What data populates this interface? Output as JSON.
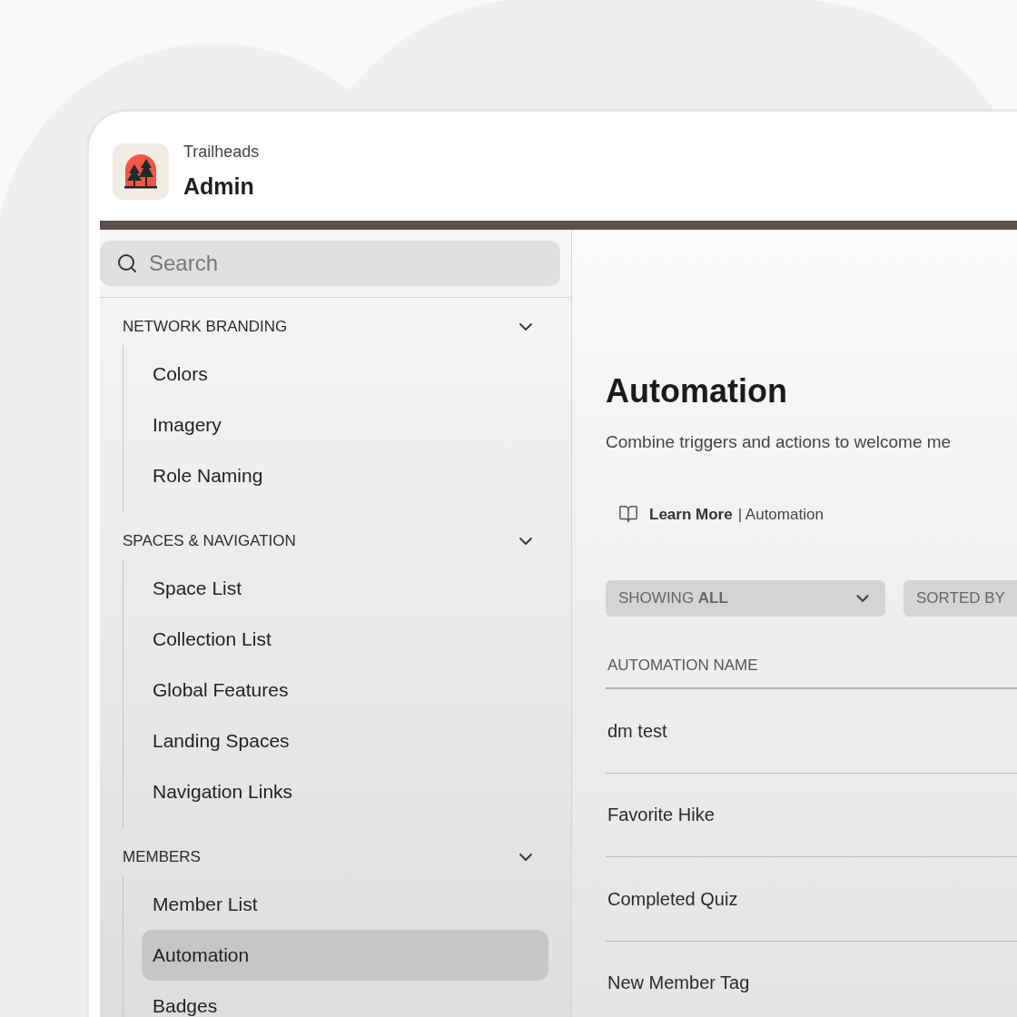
{
  "app": {
    "name": "Trailheads",
    "title": "Admin"
  },
  "sidebar": {
    "search": {
      "placeholder": "Search"
    },
    "sections": [
      {
        "title": "NETWORK BRANDING",
        "expanded": true,
        "items": [
          {
            "label": "Colors",
            "selected": false
          },
          {
            "label": "Imagery",
            "selected": false
          },
          {
            "label": "Role Naming",
            "selected": false
          }
        ]
      },
      {
        "title": "SPACES & NAVIGATION",
        "expanded": true,
        "items": [
          {
            "label": "Space List",
            "selected": false
          },
          {
            "label": "Collection List",
            "selected": false
          },
          {
            "label": "Global Features",
            "selected": false
          },
          {
            "label": "Landing Spaces",
            "selected": false
          },
          {
            "label": "Navigation Links",
            "selected": false
          }
        ]
      },
      {
        "title": "MEMBERS",
        "expanded": true,
        "items": [
          {
            "label": "Member List",
            "selected": false
          },
          {
            "label": "Automation",
            "selected": true
          },
          {
            "label": "Badges",
            "selected": false
          }
        ]
      }
    ]
  },
  "main": {
    "title": "Automation",
    "description": "Combine triggers and actions to welcome me",
    "learn_more": {
      "link": "Learn More",
      "topic": "| Automation"
    },
    "filters": [
      {
        "label": "SHOWING **ALL**",
        "kind": "dropdown"
      },
      {
        "label": "SORTED BY",
        "kind": "cut"
      }
    ],
    "table": {
      "columns": [
        "AUTOMATION NAME"
      ],
      "rows": [
        [
          "dm test"
        ],
        [
          "Favorite Hike"
        ],
        [
          "Completed Quiz"
        ],
        [
          "New Member Tag"
        ]
      ]
    }
  }
}
